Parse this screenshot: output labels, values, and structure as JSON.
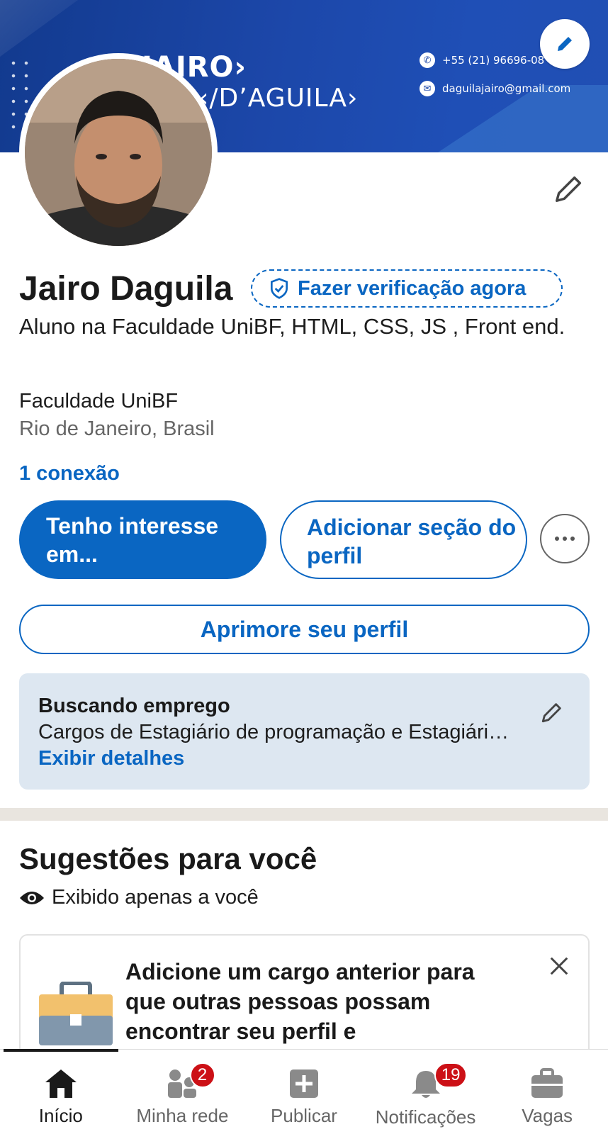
{
  "banner": {
    "name_text": "JAIRO›",
    "sub_text": "‹/D’AGUILA›",
    "phone": "+55 (21) 96696-08",
    "email": "daguilajairo@gmail.com"
  },
  "profile": {
    "name": "Jairo Daguila",
    "verify_label": "Fazer verificação agora",
    "headline": "Aluno na Faculdade UniBF, HTML, CSS, JS , Front end.",
    "school": "Faculdade UniBF",
    "location": "Rio de Janeiro, Brasil",
    "connections": "1 conexão"
  },
  "actions": {
    "primary_label": "Tenho interesse em...",
    "add_section_label": "Adicionar seção do perfil",
    "improve_label": "Aprimore seu perfil"
  },
  "open_to_work": {
    "title": "Buscando emprego",
    "text": "Cargos de Estagiário de programação e Estagiário de desenvolvimento",
    "link": "Exibir detalhes"
  },
  "suggestions": {
    "title": "Sugestões para você",
    "privacy": "Exibido apenas a você",
    "card_text": "Adicione um cargo anterior para que outras pessoas possam encontrar seu perfil e"
  },
  "nav": {
    "items": [
      {
        "label": "Início",
        "icon": "home-icon",
        "badge": ""
      },
      {
        "label": "Minha rede",
        "icon": "network-icon",
        "badge": "2"
      },
      {
        "label": "Publicar",
        "icon": "post-icon",
        "badge": ""
      },
      {
        "label": "Notificações",
        "icon": "bell-icon",
        "badge": "19"
      },
      {
        "label": "Vagas",
        "icon": "jobs-icon",
        "badge": ""
      }
    ]
  },
  "colors": {
    "accent": "#0a66c2",
    "badge": "#cc1016",
    "banner": "#1c47a9"
  }
}
